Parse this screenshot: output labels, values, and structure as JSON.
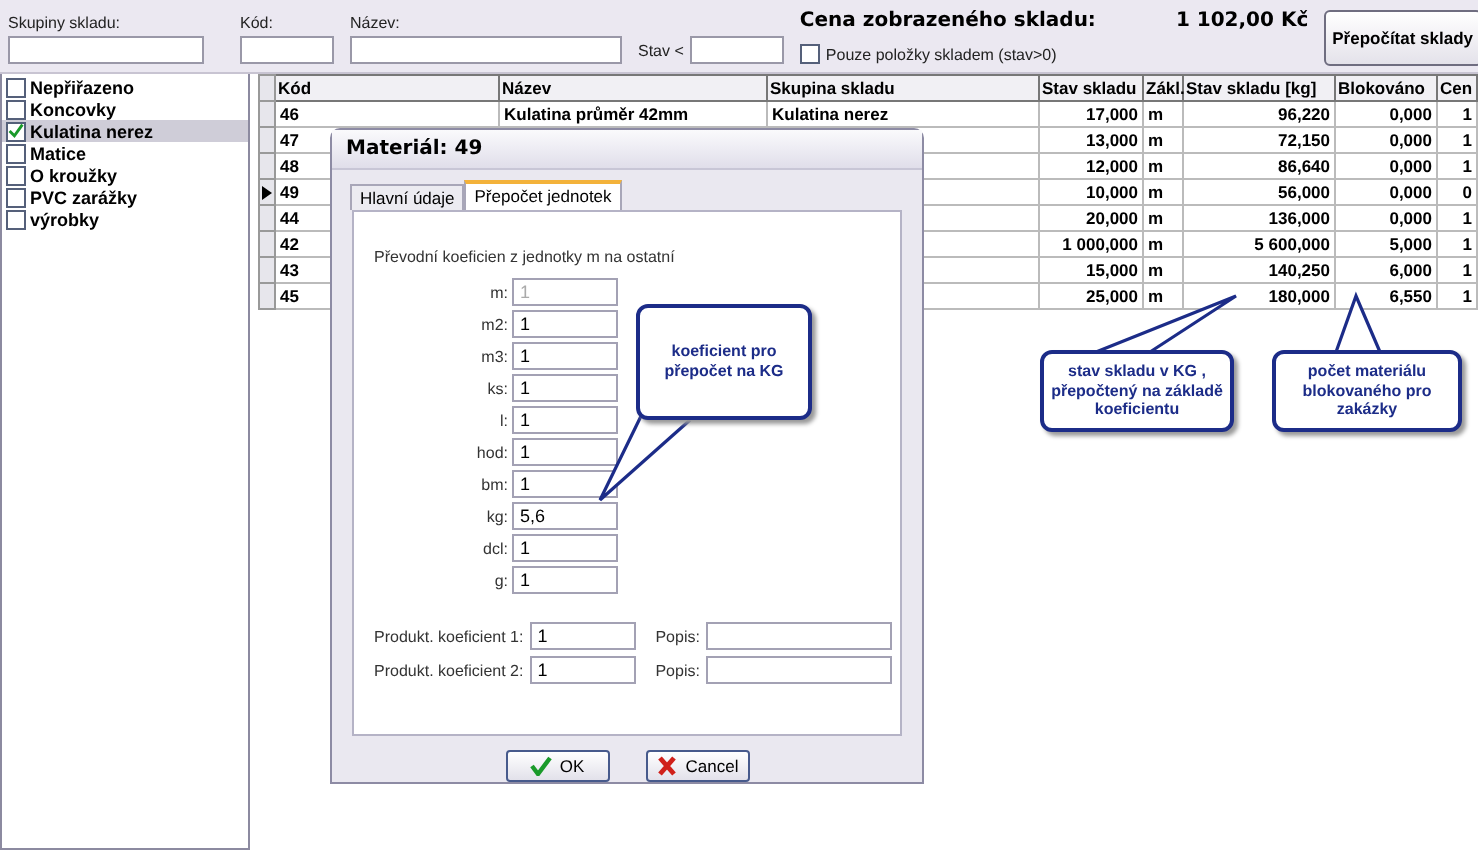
{
  "filter": {
    "groups_label": "Skupiny skladu:",
    "code_label": "Kód:",
    "name_label": "Název:",
    "stock_label": "Stav <",
    "in_stock_only": {
      "label": "Pouze položky skladem (stav>0)",
      "checked": false
    },
    "total_label": "Cena zobrazeného skladu:",
    "total_value": "1 102,00 Kč",
    "recalc_button": "Přepočítat sklady"
  },
  "groups": [
    {
      "label": "Nepřiřazeno",
      "checked": false,
      "selected": false
    },
    {
      "label": "Koncovky",
      "checked": false,
      "selected": false
    },
    {
      "label": "Kulatina nerez",
      "checked": true,
      "selected": true
    },
    {
      "label": "Matice",
      "checked": false,
      "selected": false
    },
    {
      "label": "O kroužky",
      "checked": false,
      "selected": false
    },
    {
      "label": "PVC zarážky",
      "checked": false,
      "selected": false
    },
    {
      "label": "výrobky",
      "checked": false,
      "selected": false
    }
  ],
  "table": {
    "columns": [
      "Kód",
      "Název",
      "Skupina skladu",
      "Stav skladu",
      "Zákl.",
      "Stav skladu [kg]",
      "Blokováno",
      "Cen"
    ],
    "rows": [
      {
        "current": false,
        "cells": [
          "46",
          "Kulatina průměr 42mm",
          "Kulatina nerez",
          "17,000",
          "m",
          "96,220",
          "0,000",
          "1"
        ]
      },
      {
        "current": false,
        "cells": [
          "47",
          "",
          "",
          "13,000",
          "m",
          "72,150",
          "0,000",
          "1"
        ]
      },
      {
        "current": false,
        "cells": [
          "48",
          "",
          "",
          "12,000",
          "m",
          "86,640",
          "0,000",
          "1"
        ]
      },
      {
        "current": true,
        "cells": [
          "49",
          "",
          "",
          "10,000",
          "m",
          "56,000",
          "0,000",
          "0"
        ]
      },
      {
        "current": false,
        "cells": [
          "44",
          "",
          "",
          "20,000",
          "m",
          "136,000",
          "0,000",
          "1"
        ]
      },
      {
        "current": false,
        "cells": [
          "42",
          "",
          "",
          "1 000,000",
          "m",
          "5 600,000",
          "5,000",
          "1"
        ]
      },
      {
        "current": false,
        "cells": [
          "43",
          "",
          "",
          "15,000",
          "m",
          "140,250",
          "6,000",
          "1"
        ]
      },
      {
        "current": false,
        "cells": [
          "45",
          "",
          "",
          "25,000",
          "m",
          "180,000",
          "6,550",
          "1"
        ]
      }
    ]
  },
  "dialog": {
    "title": "Materiál: 49",
    "tabs": [
      {
        "label": "Hlavní údaje",
        "selected": false
      },
      {
        "label": "Přepočet jednotek",
        "selected": true
      }
    ],
    "intro": "Převodní koeficien z jednotky m na ostatní",
    "units": [
      {
        "label": "m:",
        "value": "1",
        "disabled": true
      },
      {
        "label": "m2:",
        "value": "1",
        "disabled": false
      },
      {
        "label": "m3:",
        "value": "1",
        "disabled": false
      },
      {
        "label": "ks:",
        "value": "1",
        "disabled": false
      },
      {
        "label": "l:",
        "value": "1",
        "disabled": false
      },
      {
        "label": "hod:",
        "value": "1",
        "disabled": false
      },
      {
        "label": "bm:",
        "value": "1",
        "disabled": false
      },
      {
        "label": "kg:",
        "value": "5,6",
        "disabled": false
      },
      {
        "label": "dcl:",
        "value": "1",
        "disabled": false
      },
      {
        "label": "g:",
        "value": "1",
        "disabled": false
      }
    ],
    "products": [
      {
        "label": "Produkt. koeficient 1:",
        "value": "1",
        "desc_label": "Popis:"
      },
      {
        "label": "Produkt. koeficient 2:",
        "value": "1",
        "desc_label": "Popis:"
      }
    ],
    "ok_button": "OK",
    "cancel_button": "Cancel"
  },
  "callouts": [
    {
      "text": "koeficient pro přepočet na KG"
    },
    {
      "text": "stav skladu v KG , přepočtený na základě koeficientu"
    },
    {
      "text": "počet materiálu blokovaného pro zakázky"
    }
  ]
}
